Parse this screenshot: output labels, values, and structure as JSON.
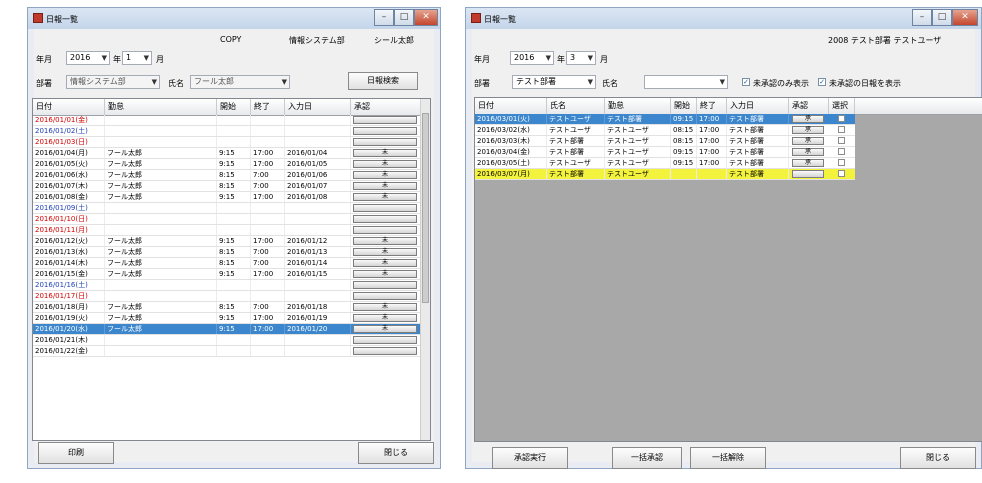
{
  "left": {
    "window_title": "日報一覧",
    "header": {
      "copy": "COPY",
      "info": "情報システム部",
      "user": "シール太郎"
    },
    "year_label": "年月",
    "year_value": "2016",
    "year_unit": "年",
    "month_value": "1",
    "month_unit": "月",
    "dept_label": "部署",
    "dept_value": "情報システム部",
    "staff_label": "氏名",
    "staff_value": "フール太郎",
    "search_button": "日報検索",
    "columns": [
      "日付",
      "勤怠",
      "開始",
      "終了",
      "入力日",
      "承認"
    ],
    "rows": [
      {
        "date": "2016/01/01(金)",
        "color": "red",
        "kintai": "",
        "start": "",
        "end": "",
        "input": "",
        "approve": ""
      },
      {
        "date": "2016/01/02(土)",
        "color": "blue",
        "kintai": "",
        "start": "",
        "end": "",
        "input": "",
        "approve": ""
      },
      {
        "date": "2016/01/03(日)",
        "color": "red",
        "kintai": "",
        "start": "",
        "end": "",
        "input": "",
        "approve": ""
      },
      {
        "date": "2016/01/04(月)",
        "color": "black",
        "kintai": "フール太郎",
        "start": "9:15",
        "end": "17:00",
        "input": "2016/01/04",
        "approve": "未"
      },
      {
        "date": "2016/01/05(火)",
        "color": "black",
        "kintai": "フール太郎",
        "start": "9:15",
        "end": "17:00",
        "input": "2016/01/05",
        "approve": "未"
      },
      {
        "date": "2016/01/06(水)",
        "color": "black",
        "kintai": "フール太郎",
        "start": "8:15",
        "end": "7:00",
        "input": "2016/01/06",
        "approve": "未"
      },
      {
        "date": "2016/01/07(木)",
        "color": "black",
        "kintai": "フール太郎",
        "start": "8:15",
        "end": "7:00",
        "input": "2016/01/07",
        "approve": "未"
      },
      {
        "date": "2016/01/08(金)",
        "color": "black",
        "kintai": "フール太郎",
        "start": "9:15",
        "end": "17:00",
        "input": "2016/01/08",
        "approve": "未"
      },
      {
        "date": "2016/01/09(土)",
        "color": "blue",
        "kintai": "",
        "start": "",
        "end": "",
        "input": "",
        "approve": ""
      },
      {
        "date": "2016/01/10(日)",
        "color": "red",
        "kintai": "",
        "start": "",
        "end": "",
        "input": "",
        "approve": ""
      },
      {
        "date": "2016/01/11(月)",
        "color": "red",
        "kintai": "",
        "start": "",
        "end": "",
        "input": "",
        "approve": ""
      },
      {
        "date": "2016/01/12(火)",
        "color": "black",
        "kintai": "フール太郎",
        "start": "9:15",
        "end": "17:00",
        "input": "2016/01/12",
        "approve": "未"
      },
      {
        "date": "2016/01/13(水)",
        "color": "black",
        "kintai": "フール太郎",
        "start": "8:15",
        "end": "7:00",
        "input": "2016/01/13",
        "approve": "未"
      },
      {
        "date": "2016/01/14(木)",
        "color": "black",
        "kintai": "フール太郎",
        "start": "8:15",
        "end": "7:00",
        "input": "2016/01/14",
        "approve": "未"
      },
      {
        "date": "2016/01/15(金)",
        "color": "black",
        "kintai": "フール太郎",
        "start": "9:15",
        "end": "17:00",
        "input": "2016/01/15",
        "approve": "未"
      },
      {
        "date": "2016/01/16(土)",
        "color": "blue",
        "kintai": "",
        "start": "",
        "end": "",
        "input": "",
        "approve": ""
      },
      {
        "date": "2016/01/17(日)",
        "color": "red",
        "kintai": "",
        "start": "",
        "end": "",
        "input": "",
        "approve": ""
      },
      {
        "date": "2016/01/18(月)",
        "color": "black",
        "kintai": "フール太郎",
        "start": "8:15",
        "end": "7:00",
        "input": "2016/01/18",
        "approve": "未"
      },
      {
        "date": "2016/01/19(火)",
        "color": "black",
        "kintai": "フール太郎",
        "start": "9:15",
        "end": "17:00",
        "input": "2016/01/19",
        "approve": "未"
      },
      {
        "date": "2016/01/20(水)",
        "color": "selected",
        "kintai": "フール太郎",
        "start": "9:15",
        "end": "17:00",
        "input": "2016/01/20",
        "approve": "未"
      },
      {
        "date": "2016/01/21(木)",
        "color": "black",
        "kintai": "",
        "start": "",
        "end": "",
        "input": "",
        "approve": ""
      },
      {
        "date": "2016/01/22(金)",
        "color": "black",
        "kintai": "",
        "start": "",
        "end": "",
        "input": "",
        "approve": ""
      }
    ],
    "bottom_left_button": "印刷",
    "bottom_right_button": "閉じる"
  },
  "right": {
    "window_title": "日報一覧",
    "header": {
      "info": "2008 テスト部署 テストユーザ"
    },
    "year_label": "年月",
    "year_value": "2016",
    "year_unit": "年",
    "month_value": "3",
    "month_unit": "月",
    "dept_label": "部署",
    "dept_value": "テスト部署",
    "staff_label": "氏名",
    "staff_value": "",
    "check1_label": "未承認のみ表示",
    "check2_label": "未承認の日報を表示",
    "columns": [
      "日付",
      "氏名",
      "勤怠",
      "開始",
      "終了",
      "入力日",
      "承認",
      "選択"
    ],
    "rows": [
      {
        "date": "2016/03/01(火)",
        "name": "テストユーザ",
        "kintai": "テスト部署",
        "start": "09:15",
        "end": "17:00",
        "input": "テスト部署",
        "state": "selected",
        "checked": true
      },
      {
        "date": "2016/03/02(水)",
        "name": "テストユーザ",
        "kintai": "テストユーザ",
        "start": "08:15",
        "end": "17:00",
        "input": "テスト部署",
        "state": "normal",
        "checked": false
      },
      {
        "date": "2016/03/03(木)",
        "name": "テスト部署",
        "kintai": "テストユーザ",
        "start": "08:15",
        "end": "17:00",
        "input": "テスト部署",
        "state": "normal",
        "checked": false
      },
      {
        "date": "2016/03/04(金)",
        "name": "テスト部署",
        "kintai": "テストユーザ",
        "start": "09:15",
        "end": "17:00",
        "input": "テスト部署",
        "state": "normal",
        "checked": false
      },
      {
        "date": "2016/03/05(土)",
        "name": "テストユーザ",
        "kintai": "テストユーザ",
        "start": "09:15",
        "end": "17:00",
        "input": "テスト部署",
        "state": "normal",
        "checked": false
      },
      {
        "date": "2016/03/07(月)",
        "name": "テスト部署",
        "kintai": "テストユーザ",
        "start": "",
        "end": "",
        "input": "テスト部署",
        "state": "yellow",
        "checked": false
      }
    ],
    "approve_button": "承",
    "buttons": [
      "承認実行",
      "一括承認",
      "一括解除",
      "閉じる"
    ]
  },
  "colors": {
    "selected": "#3b86cc",
    "highlight": "#f3f23c",
    "holiday": "#d00000",
    "saturday": "#1d3fb5"
  }
}
